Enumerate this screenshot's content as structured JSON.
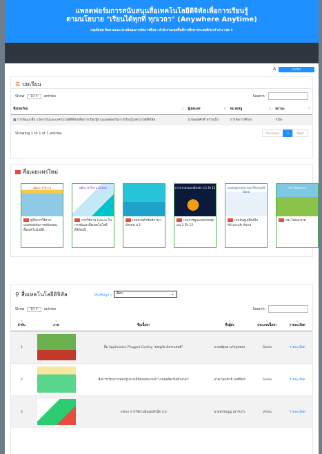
{
  "header": {
    "title_line1": "แพลตฟอร์มการสนับสนุนสื่อเทคโนโลยีดิจิทัลเพื่อการเรียนรู้",
    "title_line2": "ตามนโยบาย \"เรียนได้ทุกที่ ทุกเวลา\" (Anywhere Anytime)",
    "subtitle": "กลุ่มนิเทศ ติดตามและประเมินผลการจัดการศึกษา สำนักงานเขตพื้นที่การศึกษาประถมศึกษาลำปาง เขต 1"
  },
  "userbar": {
    "user_label": "center"
  },
  "lessons": {
    "title": "บทเรียน",
    "show_label": "Show",
    "entries_value": "10",
    "entries_label": "entries",
    "search_label": "Search:",
    "columns": [
      "ชื่อบทเรียน",
      "ผู้เผยแพร่",
      "หมวดหมู่",
      "สถานะ"
    ],
    "rows": [
      {
        "name": "การพัฒนาสื่อ นวัตกรรมและเทคโนโลยีดิจิทัลเพื่อการเรียนรู้ผ่านแพลตฟอร์มการเรียนรู้เทคโนโลยีดิจิทัล",
        "publisher": "นายพงษ์ศักดิ์ ทรายเป็ง",
        "category": "การจัดการศึกษา",
        "status": "ปิด"
      }
    ],
    "showing": "Showing 1 to 1 of 1 entries",
    "pager": {
      "previous": "Previous",
      "current": "1",
      "next": "Next"
    }
  },
  "media": {
    "title": "สื่อเผยแพร่ใหม่",
    "cards": [
      {
        "thumb_text": "คู่มือการใช้งาน",
        "caption": "คู่มือการใช้งานแพลตฟอร์มการสนับสนุน สื่อเทคโนโลยีดิ..."
      },
      {
        "thumb_text": "คู่มือการใช้งาน Canva",
        "caption": "การใช้งาน Canva ในการพัฒนาสื่อเทคโนโลยีดิจิทัลเพื่..."
      },
      {
        "thumb_text": "",
        "caption": "เกมทายคำศัพท์ภาษาอังกฤษ ป.1"
      },
      {
        "thumb_text": "การบวกลบแบบตั้งหลัก ป.1 ถึง 12",
        "caption": "เกมการคูณเลขแบบสุ่ม แม่ 2 ถึง 12"
      },
      {
        "thumb_text": "เกมจับคู่ส่วนประกอบ Microsoft Word",
        "caption": "เกมจับคู่เครื่องมือ Microsoft Word"
      },
      {
        "thumb_text": "ประโยคสะอาด",
        "caption": "ประโยคสะอาด"
      }
    ]
  },
  "tech": {
    "title": "สื่อเทคโนโลยีดิจิทัล",
    "category_label": "กรองข้อมูล »",
    "category_value": "เลือก...",
    "show_label": "Show",
    "entries_value": "10",
    "entries_label": "entries",
    "search_label": "Search:",
    "columns": [
      "ลำดับ",
      "ภาพ",
      "ชื่อเนื้อหา",
      "ชื่อผู้ส่ง",
      "ประเภทเนื้อหา",
      "รายละเอียด"
    ],
    "rows": [
      {
        "no": "1",
        "title": "สื่อ Application Plugged Coding \"ผจญภัย มังกรแสนดี\"",
        "sender": "นายณัฐพล แก้วพูลทอง",
        "type": "Game",
        "detail": "รายละเอียด"
      },
      {
        "no": "2",
        "title": "สื่อการเรียนการสอนรูปแบบดิจิทัลออนเกมส์ \"เกมผลคิดเชิงคำนวณ\"",
        "sender": "นายเกษมชาติ พงศ์ทิพย์",
        "type": "Game",
        "detail": "รายละเอียด"
      },
      {
        "no": "3",
        "title": "video การใช้งานอินเตอร์เน็ต ป.4",
        "sender": "นายธรรมนูญ เสาร์แก้ว",
        "type": "Video",
        "detail": "รายละเอียด"
      }
    ]
  },
  "colors": {
    "brand": "#1e90ff",
    "navbar": "#2f3640",
    "card_border": "#4caf50",
    "accent_red": "#e74c3c"
  }
}
